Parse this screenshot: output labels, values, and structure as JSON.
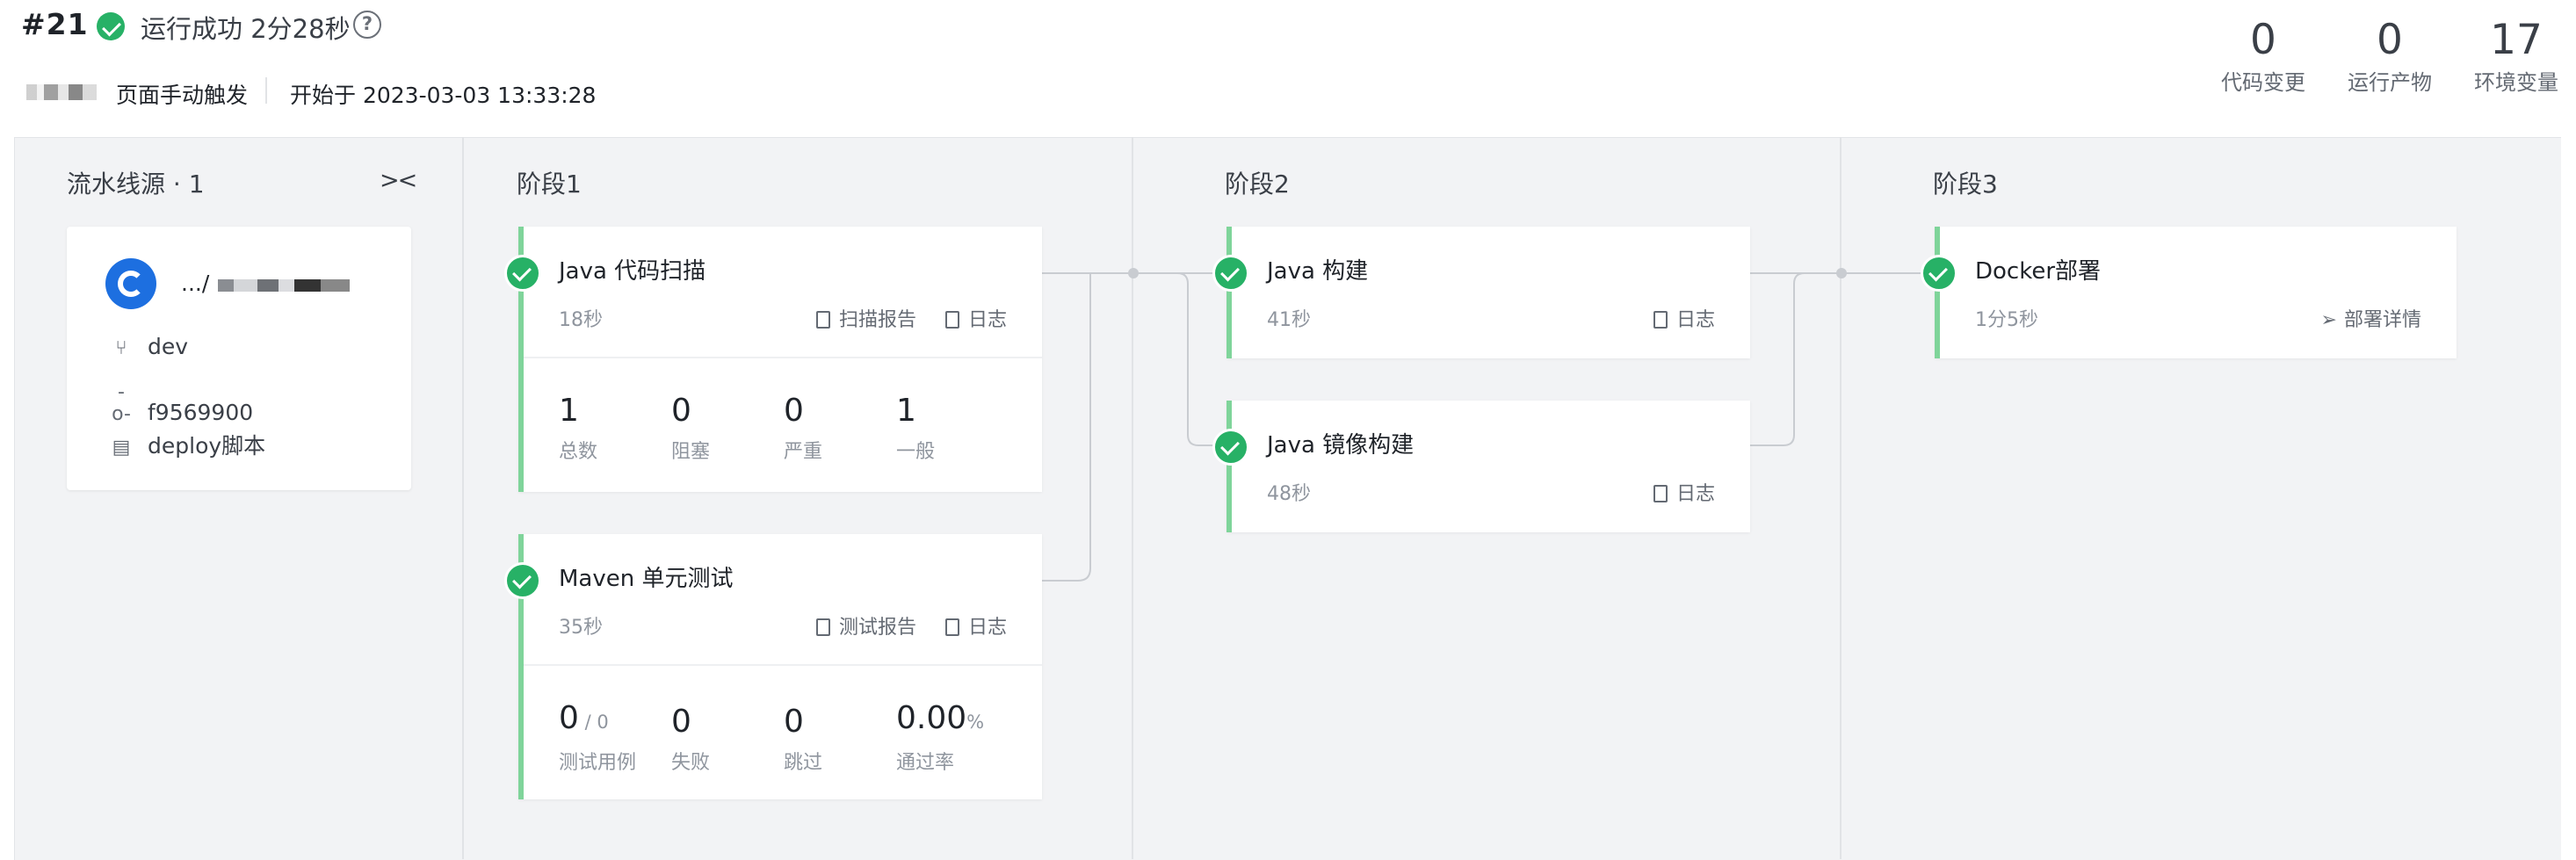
{
  "header": {
    "run_id": "#21",
    "status_text": "运行成功 2分28秒",
    "help_label": "?",
    "trigger_text": "页面手动触发",
    "start_text": "开始于 2023-03-03 13:33:28"
  },
  "stats": [
    {
      "value": "0",
      "label": "代码变更"
    },
    {
      "value": "0",
      "label": "运行产物"
    },
    {
      "value": "17",
      "label": "环境变量"
    }
  ],
  "source": {
    "title": "流水线源 · 1",
    "repo_name": ".../",
    "branch": "dev",
    "commit": "f9569900",
    "script": "deploy脚本"
  },
  "stages": [
    {
      "title": "阶段1"
    },
    {
      "title": "阶段2"
    },
    {
      "title": "阶段3"
    }
  ],
  "tasks": {
    "java_scan": {
      "title": "Java 代码扫描",
      "duration": "18秒",
      "action1": "扫描报告",
      "action2": "日志",
      "metrics": [
        {
          "value": "1",
          "label": "总数"
        },
        {
          "value": "0",
          "label": "阻塞"
        },
        {
          "value": "0",
          "label": "严重"
        },
        {
          "value": "1",
          "label": "一般"
        }
      ]
    },
    "maven_test": {
      "title": "Maven 单元测试",
      "duration": "35秒",
      "action1": "测试报告",
      "action2": "日志",
      "metrics": [
        {
          "value": "0",
          "sub": " / 0",
          "label": "测试用例"
        },
        {
          "value": "0",
          "sub": "",
          "label": "失败"
        },
        {
          "value": "0",
          "sub": "",
          "label": "跳过"
        },
        {
          "value": "0.00",
          "sub": "%",
          "label": "通过率"
        }
      ]
    },
    "java_build": {
      "title": "Java 构建",
      "duration": "41秒",
      "action": "日志"
    },
    "java_image": {
      "title": "Java 镜像构建",
      "duration": "48秒",
      "action": "日志"
    },
    "docker_deploy": {
      "title": "Docker部署",
      "duration": "1分5秒",
      "action": "部署详情"
    }
  },
  "colors": {
    "success": "#27b166",
    "card_accent": "#7fd49a",
    "background": "#f2f3f5"
  }
}
